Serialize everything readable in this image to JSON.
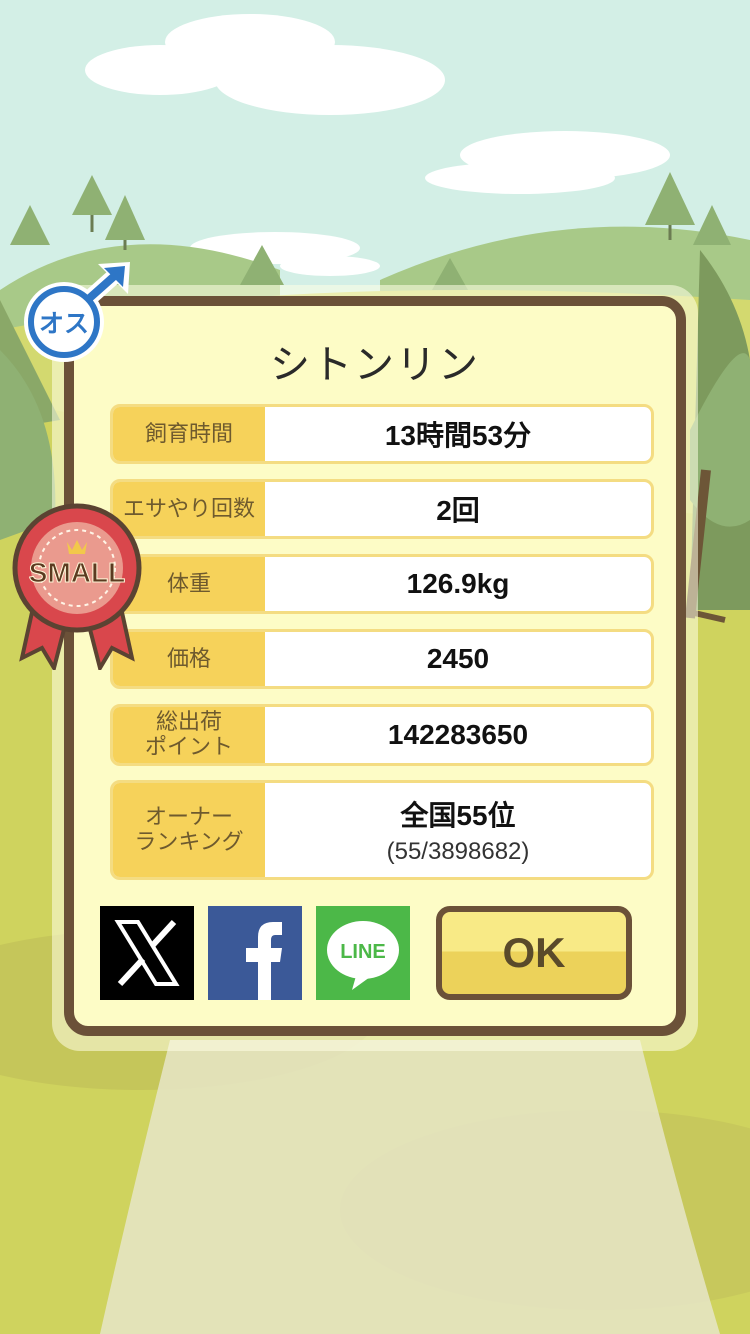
{
  "title": "シトンリン",
  "gender_badge": "オス",
  "rank_medal": "SMALL",
  "stats": [
    {
      "label": "飼育時間",
      "value": "13時間53分"
    },
    {
      "label": "エサやり回数",
      "value": "2回"
    },
    {
      "label": "体重",
      "value": "126.9kg"
    },
    {
      "label": "価格",
      "value": "2450"
    },
    {
      "label": "総出荷\nポイント",
      "value": "142283650"
    },
    {
      "label": "オーナー\nランキング",
      "value": "全国55位",
      "sub": "(55/3898682)"
    }
  ],
  "share": {
    "x_icon": "x-logo-icon",
    "facebook_icon": "facebook-icon",
    "line_label": "LINE"
  },
  "ok_label": "OK",
  "colors": {
    "dialog_bg": "#fdfcc6",
    "dialog_border": "#6b5138",
    "label_bg": "#f6d25a",
    "facebook": "#3b5998",
    "line": "#4cb848",
    "medal_red": "#d9474c",
    "male_blue": "#2e76c6"
  }
}
